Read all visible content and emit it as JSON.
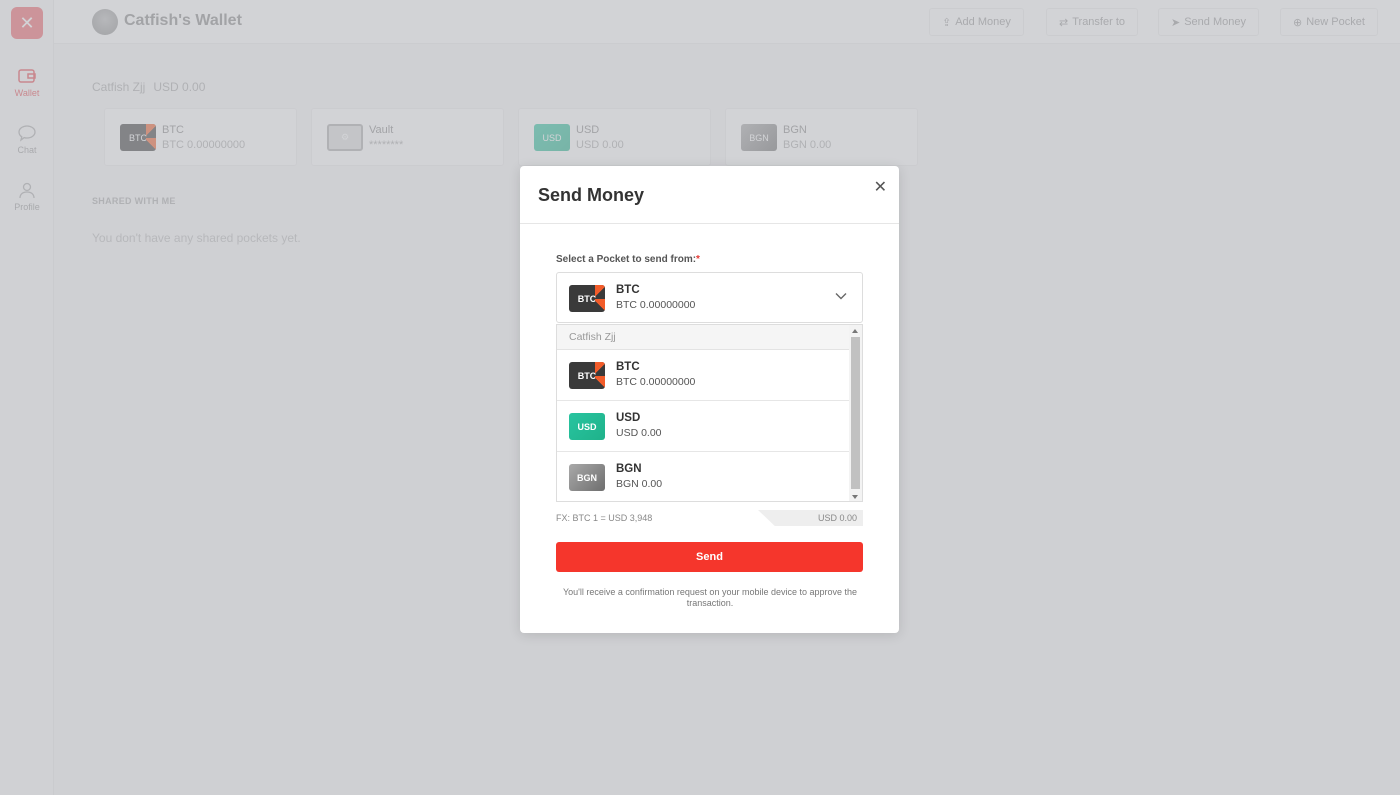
{
  "app": {
    "logo_icon": "close-x-logo",
    "title": "Catfish's Wallet"
  },
  "sidebar": {
    "items": [
      {
        "label": "Wallet",
        "icon": "wallet-icon",
        "active": true
      },
      {
        "label": "Chat",
        "icon": "chat-icon",
        "active": false
      },
      {
        "label": "Profile",
        "icon": "user-icon",
        "active": false
      }
    ]
  },
  "header": {
    "buttons": [
      {
        "label": "Add Money",
        "icon": "upload-icon"
      },
      {
        "label": "Transfer to",
        "icon": "transfer-icon"
      },
      {
        "label": "Send Money",
        "icon": "send-icon"
      },
      {
        "label": "New Pocket",
        "icon": "plus-circle-icon"
      }
    ]
  },
  "main": {
    "owner": "Catfish Zjj",
    "total": "USD 0.00",
    "pockets": [
      {
        "badge": "BTC",
        "name": "BTC",
        "value": "BTC 0.00000000"
      },
      {
        "badge": "",
        "name": "Vault",
        "value": "********"
      },
      {
        "badge": "USD",
        "name": "USD",
        "value": "USD 0.00"
      },
      {
        "badge": "BGN",
        "name": "BGN",
        "value": "BGN 0.00"
      }
    ],
    "shared_heading": "SHARED WITH ME",
    "shared_empty": "You don't have any shared pockets yet."
  },
  "modal": {
    "title": "Send Money",
    "close_icon": "close-icon",
    "field_label": "Select a Pocket to send from:",
    "required_mark": "*",
    "selected": {
      "badge": "BTC",
      "name": "BTC",
      "value": "BTC 0.00000000"
    },
    "dropdown": {
      "group": "Catfish Zjj",
      "options": [
        {
          "badge": "BTC",
          "name": "BTC",
          "value": "BTC 0.00000000"
        },
        {
          "badge": "USD",
          "name": "USD",
          "value": "USD 0.00"
        },
        {
          "badge": "BGN",
          "name": "BGN",
          "value": "BGN 0.00"
        }
      ]
    },
    "fx_rate": "FX: BTC 1 = USD 3,948",
    "converted": "USD 0.00",
    "send_label": "Send",
    "note": "You'll receive a confirmation request on your mobile device to approve the transaction."
  },
  "colors": {
    "accent": "#f5362c",
    "usd": "#28c4a0",
    "btc": "#3a3a3a",
    "btc_accent": "#f25c2a"
  }
}
